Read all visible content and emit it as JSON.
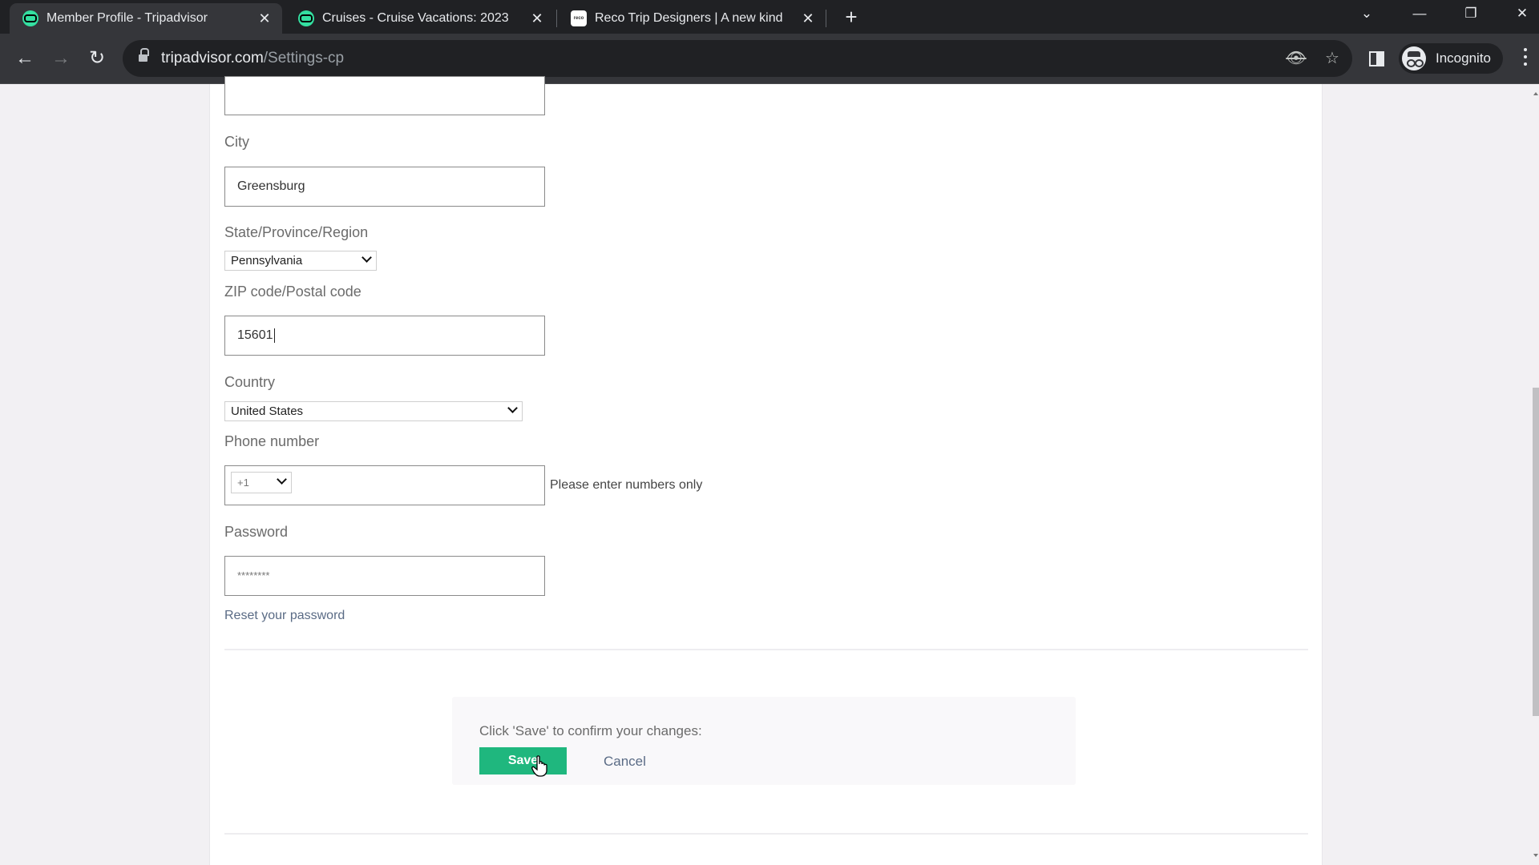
{
  "browser": {
    "tabs": [
      {
        "title": "Member Profile - Tripadvisor",
        "favicon": "tripadvisor-owl-icon",
        "active": true
      },
      {
        "title": "Cruises - Cruise Vacations: 2023",
        "favicon": "tripadvisor-owl-icon",
        "active": false
      },
      {
        "title": "Reco Trip Designers | A new kind",
        "favicon": "reco-icon",
        "active": false
      }
    ],
    "close_glyph": "✕",
    "new_tab_glyph": "+",
    "window_controls": {
      "tab_search": "⌄",
      "minimize": "—",
      "restore": "❐",
      "close": "✕"
    },
    "nav": {
      "back": "←",
      "forward": "→",
      "reload": "↻"
    },
    "url": {
      "domain": "tripadvisor.com",
      "path": "/Settings-cp"
    },
    "omnibox_icons": {
      "tracking": "👁",
      "bookmark": "☆"
    },
    "profile_label": "Incognito"
  },
  "form": {
    "top_field_value": "",
    "city": {
      "label": "City",
      "value": "Greensburg"
    },
    "state": {
      "label": "State/Province/Region",
      "value": "Pennsylvania"
    },
    "zip": {
      "label": "ZIP code/Postal code",
      "value": "15601"
    },
    "country": {
      "label": "Country",
      "value": "United States"
    },
    "phone": {
      "label": "Phone number",
      "country_code": "+1",
      "value": "",
      "helper": "Please enter numbers only"
    },
    "password": {
      "label": "Password",
      "value": "********",
      "reset_link": "Reset your password"
    }
  },
  "confirm": {
    "message": "Click 'Save' to confirm your changes:",
    "save_label": "Save",
    "cancel_label": "Cancel",
    "save_color": "#1fb77e"
  }
}
